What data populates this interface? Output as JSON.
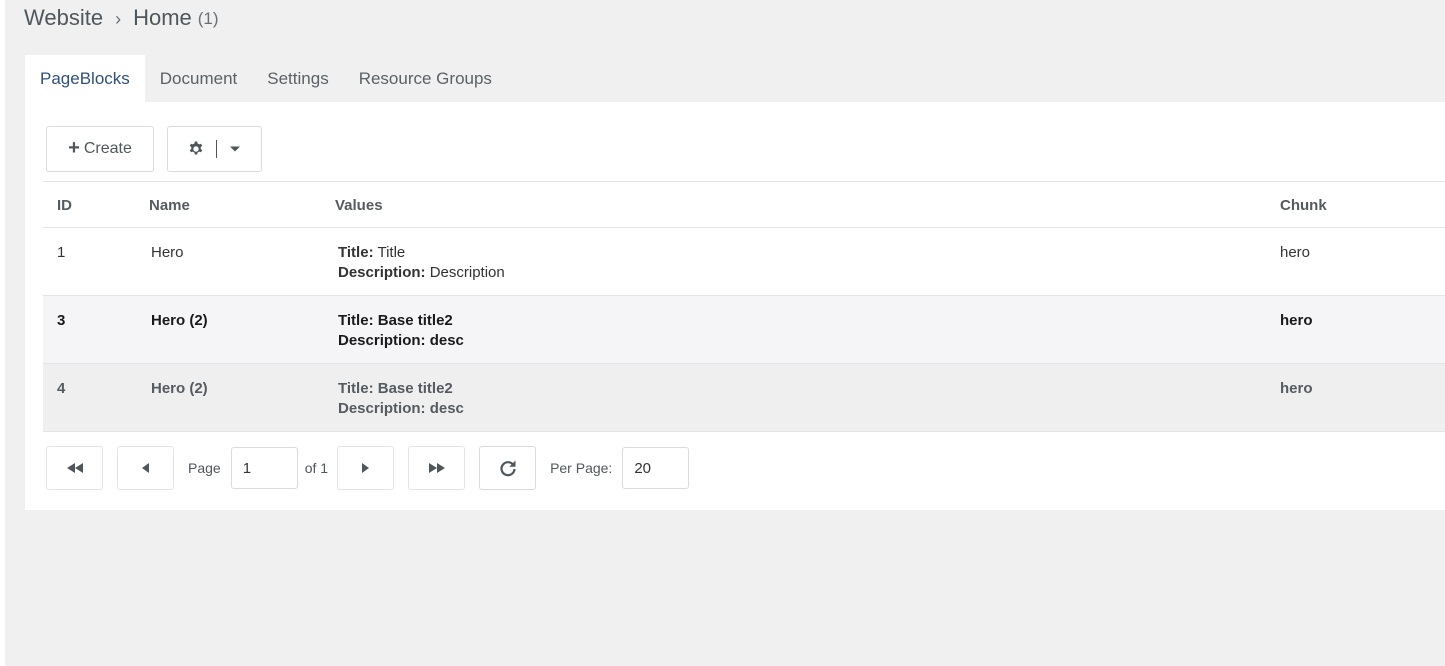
{
  "breadcrumb": {
    "parent": "Website",
    "separator": "›",
    "current": "Home",
    "count": "(1)"
  },
  "tabs": [
    {
      "label": "PageBlocks",
      "active": true
    },
    {
      "label": "Document"
    },
    {
      "label": "Settings"
    },
    {
      "label": "Resource Groups"
    }
  ],
  "toolbar": {
    "create_label": "Create",
    "create_icon": "plus-icon",
    "settings_icon": "gear-icon",
    "menu_icon": "caret-down-icon"
  },
  "grid": {
    "columns": [
      "ID",
      "Name",
      "Values",
      "Chunk"
    ],
    "rows": [
      {
        "id": "1",
        "name": "Hero",
        "title_key": "Title:",
        "title_val": "Title",
        "desc_key": "Description:",
        "desc_val": "Description",
        "chunk": "hero"
      },
      {
        "id": "3",
        "name": "Hero (2)",
        "title_key": "Title:",
        "title_val": "Base title2",
        "desc_key": "Description:",
        "desc_val": "desc",
        "chunk": "hero"
      },
      {
        "id": "4",
        "name": "Hero (2)",
        "title_key": "Title:",
        "title_val": "Base title2",
        "desc_key": "Description:",
        "desc_val": "desc",
        "chunk": "hero"
      }
    ]
  },
  "pager": {
    "page_label": "Page",
    "page_value": "1",
    "of_label": "of 1",
    "per_page_label": "Per Page:",
    "per_page_value": "20"
  },
  "colors": {
    "accent": "#2f5178",
    "background": "#f0f0f0",
    "panel": "#ffffff"
  }
}
